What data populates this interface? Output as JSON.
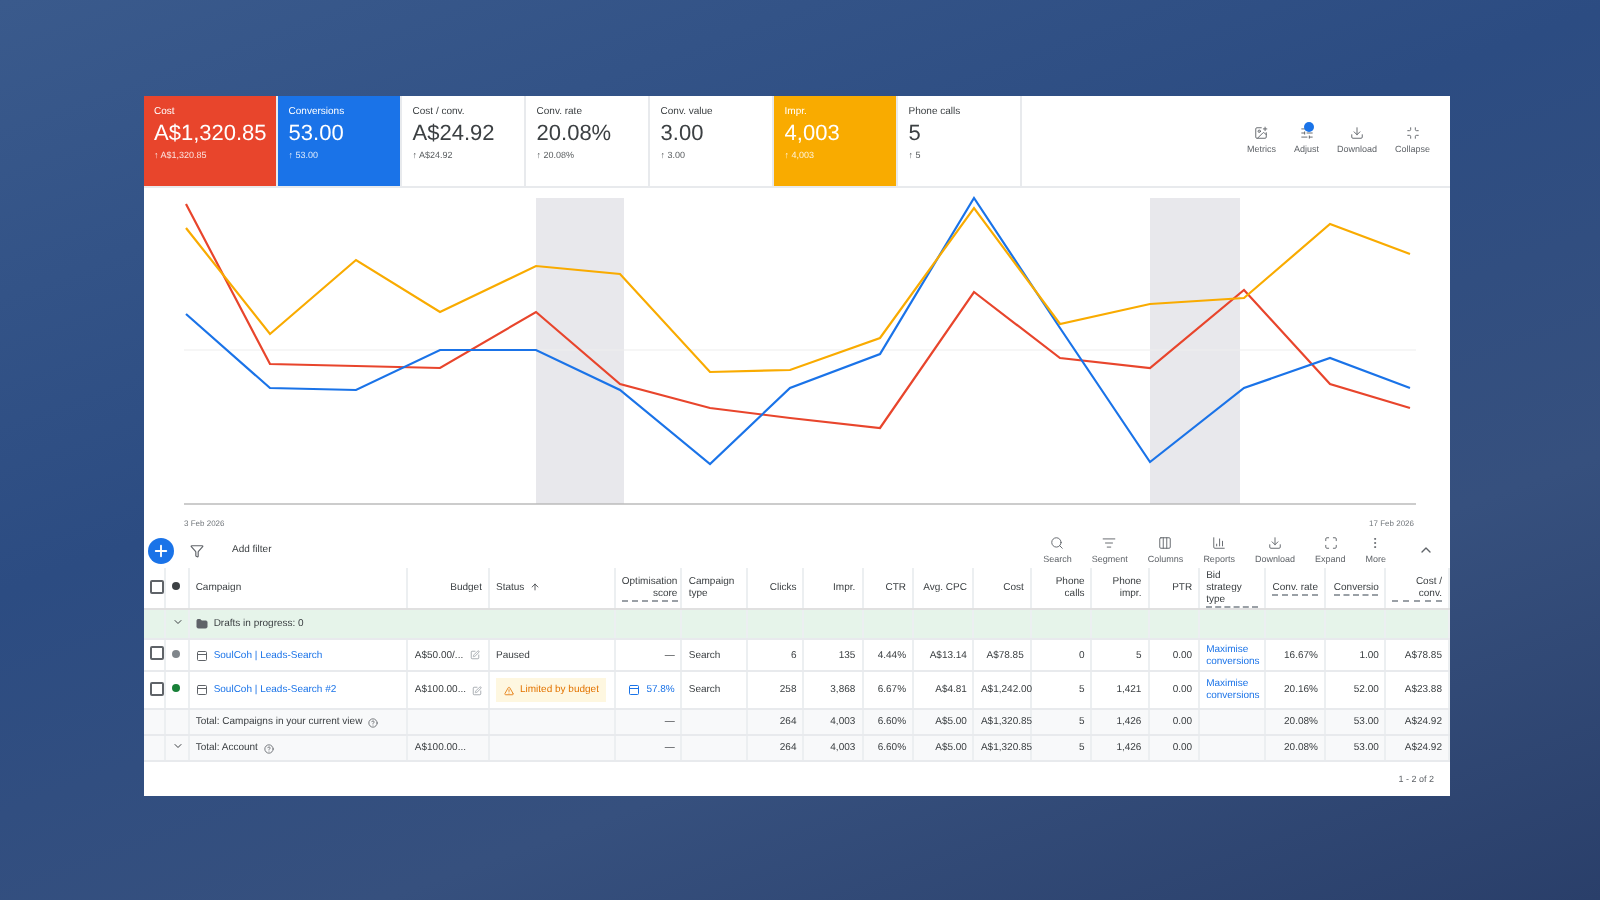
{
  "metrics": [
    {
      "label": "Cost",
      "value": "A$1,320.85",
      "delta": "↑ A$1,320.85",
      "selected": true,
      "color": "#e8452c"
    },
    {
      "label": "Conversions",
      "value": "53.00",
      "delta": "↑ 53.00",
      "selected": true,
      "color": "#1a73e8"
    },
    {
      "label": "Cost / conv.",
      "value": "A$24.92",
      "delta": "↑ A$24.92",
      "selected": false
    },
    {
      "label": "Conv. rate",
      "value": "20.08%",
      "delta": "↑ 20.08%",
      "selected": false
    },
    {
      "label": "Conv. value",
      "value": "3.00",
      "delta": "↑ 3.00",
      "selected": false
    },
    {
      "label": "Impr.",
      "value": "4,003",
      "delta": "↑ 4,003",
      "selected": true,
      "color": "#f9ab00"
    },
    {
      "label": "Phone calls",
      "value": "5",
      "delta": "↑ 5",
      "selected": false
    }
  ],
  "chart_actions": [
    "Metrics",
    "Adjust",
    "Download",
    "Collapse"
  ],
  "chart": {
    "x_start": "3 Feb 2026",
    "x_end": "17 Feb 2026"
  },
  "filter": {
    "placeholder": "Add filter"
  },
  "table_actions": [
    "Search",
    "Segment",
    "Columns",
    "Reports",
    "Download",
    "Expand",
    "More"
  ],
  "select_all": {
    "checked": false
  },
  "columns": [
    {
      "label": "Campaign",
      "kind": "text"
    },
    {
      "label": "Budget",
      "kind": "number"
    },
    {
      "label": "Status",
      "kind": "text",
      "sorted": true
    },
    {
      "label": "Optimisation score",
      "kind": "number",
      "dashed": true
    },
    {
      "label": "Campaign type",
      "kind": "text"
    },
    {
      "label": "Clicks",
      "kind": "number"
    },
    {
      "label": "Impr.",
      "kind": "number"
    },
    {
      "label": "CTR",
      "kind": "number"
    },
    {
      "label": "Avg. CPC",
      "kind": "number"
    },
    {
      "label": "Cost",
      "kind": "number"
    },
    {
      "label": "Phone calls",
      "kind": "number"
    },
    {
      "label": "Phone impr.",
      "kind": "number"
    },
    {
      "label": "PTR",
      "kind": "number"
    },
    {
      "label": "Bid strategy type",
      "kind": "text",
      "dashed": true
    },
    {
      "label": "Conv. rate",
      "kind": "number",
      "dashed": true
    },
    {
      "label": "Conversio",
      "kind": "number",
      "dashed": true
    },
    {
      "label": "Cost / conv.",
      "kind": "number",
      "dashed": true
    }
  ],
  "rows": [
    {
      "kind": "group",
      "label": "Drafts in progress: 0"
    },
    {
      "kind": "campaign",
      "checked": false,
      "color": "#80868b",
      "name": "SoulCoh | Leads-Search",
      "budget": "A$50.00/...",
      "status": {
        "kind": "plain",
        "text": "Paused"
      },
      "opt_score": "—",
      "type": "Search",
      "metrics": [
        "6",
        "135",
        "4.44%",
        "A$13.14",
        "A$78.85",
        "0",
        "5",
        "0.00"
      ],
      "bid_strategy": "Maximise conversions",
      "conversion_metrics": [
        "16.67%",
        "1.00",
        "A$78.85"
      ]
    },
    {
      "kind": "campaign",
      "checked": false,
      "color": "#188038",
      "name": "SoulCoh | Leads-Search #2",
      "budget": "A$100.00...",
      "status": {
        "kind": "warning",
        "text": "Limited by budget"
      },
      "opt_score": "57.8%",
      "type": "Search",
      "metrics": [
        "258",
        "3,868",
        "6.67%",
        "A$4.81",
        "A$1,242.00",
        "5",
        "1,421",
        "0.00"
      ],
      "bid_strategy": "Maximise conversions",
      "conversion_metrics": [
        "20.16%",
        "52.00",
        "A$23.88"
      ]
    },
    {
      "kind": "total",
      "expandable": false,
      "label": "Total: Campaigns in your current view",
      "opt_score": "—",
      "metrics": [
        "264",
        "4,003",
        "6.60%",
        "A$5.00",
        "A$1,320.85",
        "5",
        "1,426",
        "0.00"
      ],
      "conversion_metrics": [
        "20.08%",
        "53.00",
        "A$24.92"
      ]
    },
    {
      "kind": "total",
      "expandable": true,
      "label": "Total: Account",
      "budget": "A$100.00...",
      "opt_score": "—",
      "metrics": [
        "264",
        "4,003",
        "6.60%",
        "A$5.00",
        "A$1,320.85",
        "5",
        "1,426",
        "0.00"
      ],
      "conversion_metrics": [
        "20.08%",
        "53.00",
        "A$24.92"
      ]
    }
  ],
  "pagination": "1 - 2 of 2"
}
